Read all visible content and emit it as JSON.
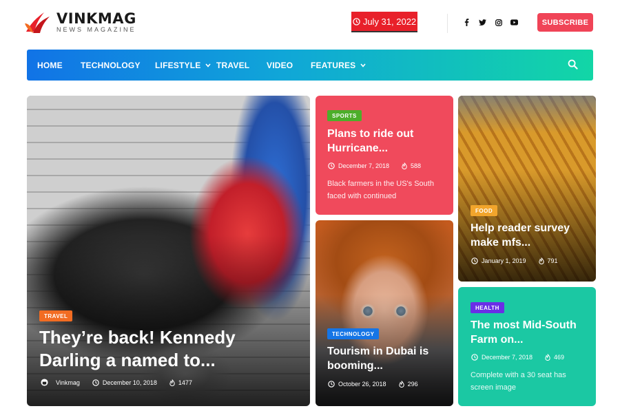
{
  "header": {
    "logo_name": "VINKMAG",
    "logo_tagline": "NEWS MAGAZINE",
    "date": "July 31, 2022",
    "subscribe_label": "SUBSCRIBE",
    "socials": [
      "facebook-icon",
      "twitter-icon",
      "instagram-icon",
      "youtube-icon"
    ]
  },
  "nav": {
    "items": [
      {
        "label": "HOME",
        "dropdown": false
      },
      {
        "label": "TECHNOLOGY",
        "dropdown": false
      },
      {
        "label": "LIFESTYLE",
        "dropdown": true
      },
      {
        "label": "TRAVEL",
        "dropdown": false
      },
      {
        "label": "VIDEO",
        "dropdown": false
      },
      {
        "label": "FEATURES",
        "dropdown": true
      }
    ],
    "search_icon": "search-icon"
  },
  "colors": {
    "brand_red": "#e8202a",
    "subscribe": "#f04457",
    "nav_gradient_start": "#1173e6",
    "nav_gradient_end": "#12d6a6",
    "badge_travel": "#f26c22",
    "badge_sports": "#4cae2a",
    "badge_food": "#f2a52c",
    "badge_technology": "#1575e6",
    "badge_health": "#6a2ee6"
  },
  "articles": {
    "travel": {
      "category": "TRAVEL",
      "title": "They’re back! Kennedy Darling a named to...",
      "author": "Vinkmag",
      "date": "December 10, 2018",
      "views": "1477"
    },
    "sports": {
      "category": "SPORTS",
      "title": "Plans to ride out Hurricane...",
      "date": "December 7, 2018",
      "views": "588",
      "excerpt": "Black farmers in the US's South faced with continued"
    },
    "food": {
      "category": "FOOD",
      "title": "Help reader survey make mfs...",
      "date": "January 1, 2019",
      "views": "791"
    },
    "technology": {
      "category": "TECHNOLOGY",
      "title": "Tourism in Dubai is booming...",
      "date": "October 26, 2018",
      "views": "296"
    },
    "health": {
      "category": "HEALTH",
      "title": "The most Mid-South Farm on...",
      "date": "December 7, 2018",
      "views": "469",
      "excerpt": "Complete with a 30 seat has screen image"
    }
  }
}
